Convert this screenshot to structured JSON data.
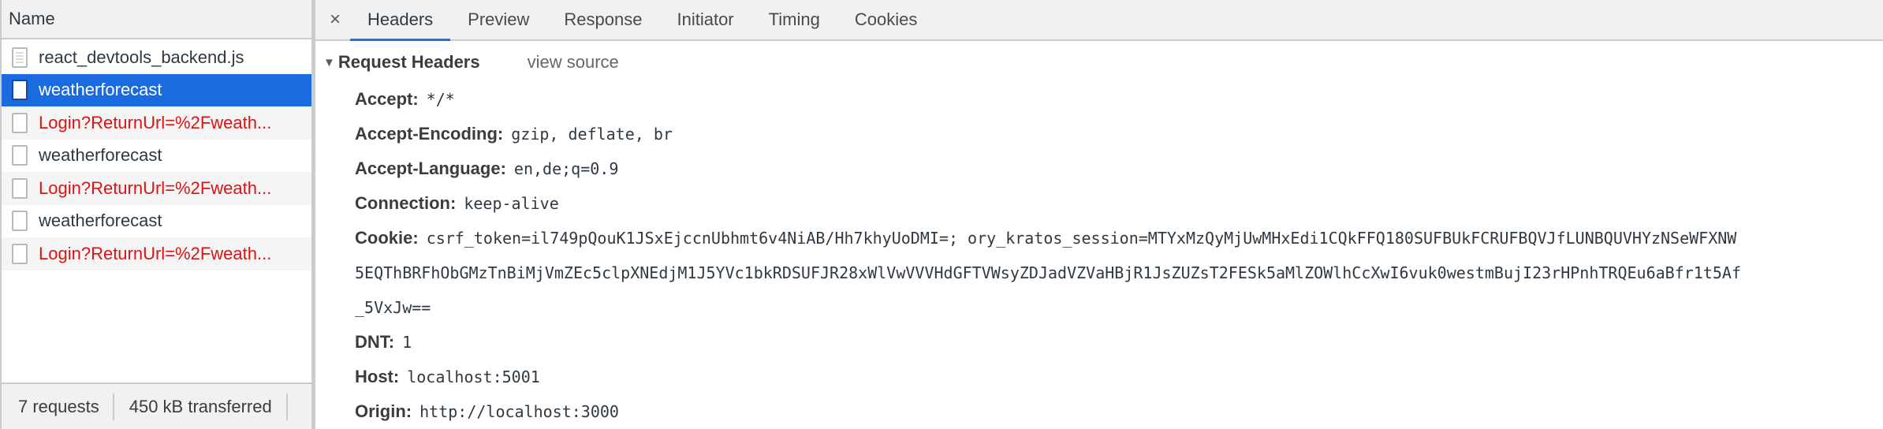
{
  "requests_panel": {
    "column_header": "Name",
    "rows": [
      {
        "name": "react_devtools_backend.js",
        "status": "normal",
        "icon": "script-file-icon"
      },
      {
        "name": "weatherforecast",
        "status": "selected",
        "icon": "document-file-icon"
      },
      {
        "name": "Login?ReturnUrl=%2Fweath...",
        "status": "error",
        "icon": "document-file-icon"
      },
      {
        "name": "weatherforecast",
        "status": "normal",
        "icon": "document-file-icon"
      },
      {
        "name": "Login?ReturnUrl=%2Fweath...",
        "status": "error",
        "icon": "document-file-icon"
      },
      {
        "name": "weatherforecast",
        "status": "normal",
        "icon": "document-file-icon"
      },
      {
        "name": "Login?ReturnUrl=%2Fweath...",
        "status": "error",
        "icon": "document-file-icon"
      }
    ],
    "footer": {
      "requests": "7 requests",
      "transferred": "450 kB transferred"
    }
  },
  "details_panel": {
    "close_icon": "×",
    "tabs": [
      {
        "label": "Headers",
        "active": true
      },
      {
        "label": "Preview",
        "active": false
      },
      {
        "label": "Response",
        "active": false
      },
      {
        "label": "Initiator",
        "active": false
      },
      {
        "label": "Timing",
        "active": false
      },
      {
        "label": "Cookies",
        "active": false
      }
    ],
    "section": {
      "toggle_icon": "▼",
      "title": "Request Headers",
      "view_source": "view source"
    },
    "headers": [
      {
        "key": "Accept:",
        "value": "*/*"
      },
      {
        "key": "Accept-Encoding:",
        "value": "gzip, deflate, br"
      },
      {
        "key": "Accept-Language:",
        "value": "en,de;q=0.9"
      },
      {
        "key": "Connection:",
        "value": "keep-alive"
      }
    ],
    "cookie": {
      "key": "Cookie:",
      "lines": [
        "csrf_token=il749pQouK1JSxEjccnUbhmt6v4NiAB/Hh7khyUoDMI=; ory_kratos_session=MTYxMzQyMjUwMHxEdi1CQkFFQ180SUFBUkFCRUFBQVJfLUNBQUVHYzNSeWFXNW",
        "5EQThBRFhObGMzTnBiMjVmZEc5clpXNEdjM1J5YVc1bkRDSUFJR28xWlVwVVVHdGFTVWsyZDJadVZVaHBjR1JsZUZsT2FESk5aMlZOWlhCcXwI6vuk0westmBujI23rHPnhTRQEu6aBfr1t5Af",
        "_5VxJw=="
      ]
    },
    "headers_after": [
      {
        "key": "DNT:",
        "value": "1"
      },
      {
        "key": "Host:",
        "value": "localhost:5001"
      },
      {
        "key": "Origin:",
        "value": "http://localhost:3000"
      }
    ]
  },
  "colors": {
    "selected_row": "#1a6ae0",
    "error_text": "#dd1313",
    "active_tab_underline": "#1a73e8"
  }
}
